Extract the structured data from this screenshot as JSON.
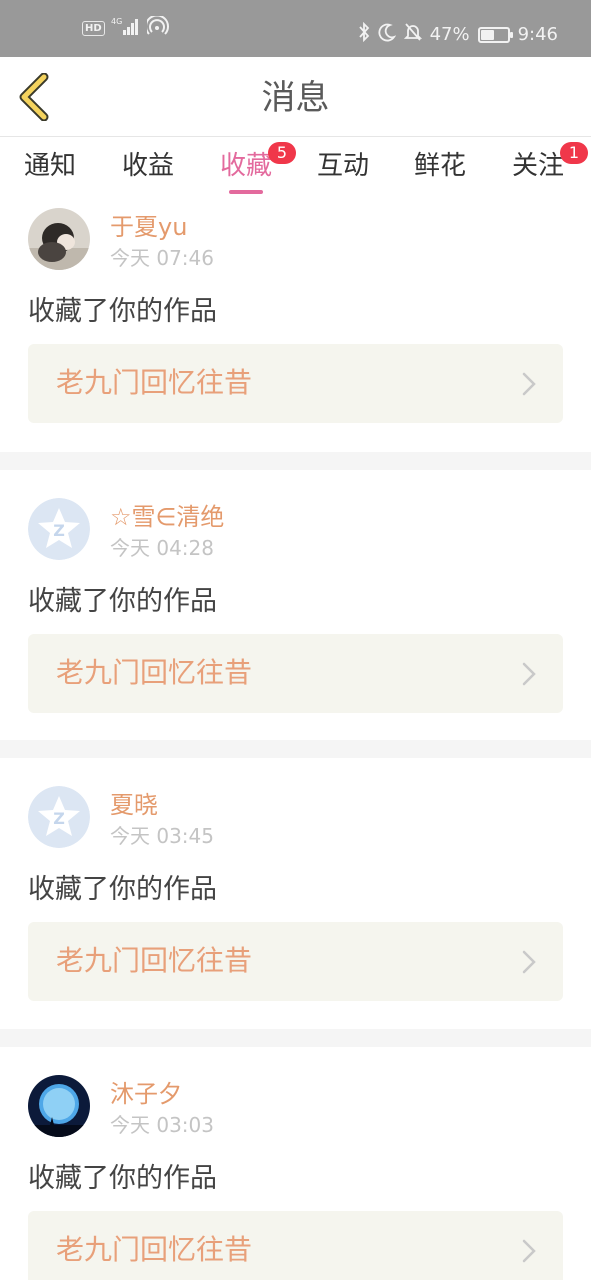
{
  "status_bar": {
    "hd": "HD",
    "network": "4G",
    "battery": "47%",
    "battery_level": 0.47,
    "time": "9:46"
  },
  "header": {
    "title": "消息"
  },
  "tabs": [
    {
      "label": "通知"
    },
    {
      "label": "收益"
    },
    {
      "label": "收藏",
      "active": true,
      "badge": "5"
    },
    {
      "label": "互动"
    },
    {
      "label": "鲜花"
    },
    {
      "label": "关注",
      "badge": "1"
    }
  ],
  "feed": [
    {
      "user": "于夏yu",
      "time": "今天 07:46",
      "action": "收藏了你的作品",
      "work": "老九门回忆往昔",
      "avatar": "photo-avatar"
    },
    {
      "user": "☆雪∈清绝",
      "time": "今天 04:28",
      "action": "收藏了你的作品",
      "work": "老九门回忆往昔",
      "avatar": "default-avatar"
    },
    {
      "user": "夏晓",
      "time": "今天 03:45",
      "action": "收藏了你的作品",
      "work": "老九门回忆往昔",
      "avatar": "default-avatar"
    },
    {
      "user": "沐子夕",
      "time": "今天 03:03",
      "action": "收藏了你的作品",
      "work": "老九门回忆往昔",
      "avatar": "moon-avatar"
    }
  ],
  "colors": {
    "accent": "#e36a9d",
    "badge": "#f0374a",
    "username": "#e49a6c",
    "work_title": "#e8a07a"
  }
}
